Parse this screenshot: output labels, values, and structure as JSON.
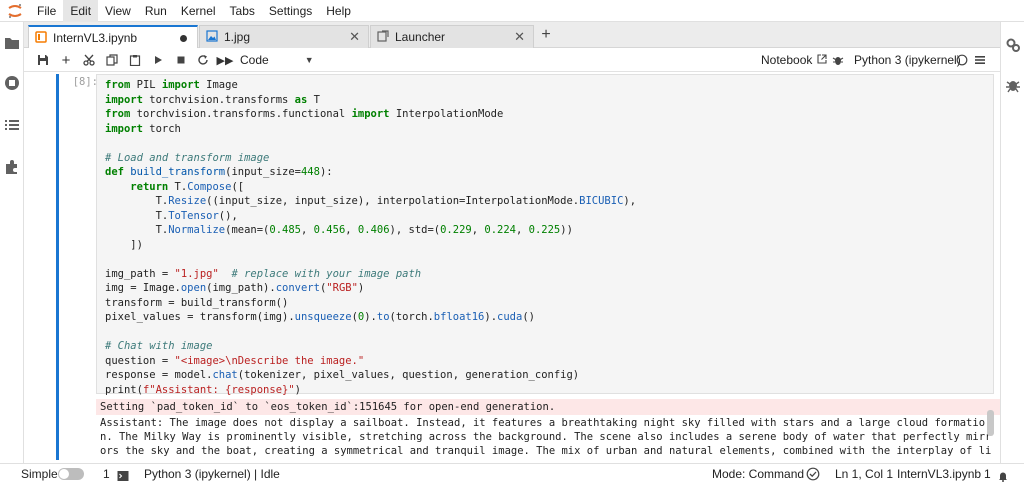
{
  "menubar": {
    "items": [
      "File",
      "Edit",
      "View",
      "Run",
      "Kernel",
      "Tabs",
      "Settings",
      "Help"
    ],
    "active_index": 1
  },
  "tabs": [
    {
      "label": "InternVL3.ipynb",
      "icon": "notebook-icon",
      "active": true,
      "dirty": true
    },
    {
      "label": "1.jpg",
      "icon": "image-icon",
      "active": false
    },
    {
      "label": "Launcher",
      "icon": "launcher-icon",
      "active": false
    }
  ],
  "toolbar": {
    "cell_type": "Code",
    "notebook_label": "Notebook",
    "kernel_label": "Python 3 (ipykernel)"
  },
  "cell": {
    "prompt": "[8]:",
    "code_lines": [
      "from PIL import Image",
      "import torchvision.transforms as T",
      "from torchvision.transforms.functional import InterpolationMode",
      "import torch",
      "",
      "# Load and transform image",
      "def build_transform(input_size=448):",
      "    return T.Compose([",
      "        T.Resize((input_size, input_size), interpolation=InterpolationMode.BICUBIC),",
      "        T.ToTensor(),",
      "        T.Normalize(mean=(0.485, 0.456, 0.406), std=(0.229, 0.224, 0.225))",
      "    ])",
      "",
      "img_path = \"1.jpg\"  # replace with your image path",
      "img = Image.open(img_path).convert(\"RGB\")",
      "transform = build_transform()",
      "pixel_values = transform(img).unsqueeze(0).to(torch.bfloat16).cuda()",
      "",
      "# Chat with image",
      "question = \"<image>\\nDescribe the image.\"",
      "response = model.chat(tokenizer, pixel_values, question, generation_config)",
      "print(f\"Assistant: {response}\")"
    ],
    "output": {
      "stderr": "Setting `pad_token_id` to `eos_token_id`:151645 for open-end generation.",
      "stdout_lines": [
        "Assistant: The image does not display a sailboat. Instead, it features a breathtaking night sky filled with stars and a large cloud formatio",
        "n. The Milky Way is prominently visible, stretching across the background. The scene also includes a serene body of water that perfectly mirr",
        "ors the sky and the boat, creating a symmetrical and tranquil image. The mix of urban and natural elements, combined with the interplay of li"
      ]
    }
  },
  "statusbar": {
    "mode_label": "Simple",
    "terminals_count": "1",
    "kernels_count": "1",
    "kernel_status": "Python 3 (ipykernel) | Idle",
    "command_mode": "Mode: Command",
    "cursor_position": "Ln 1, Col 1",
    "file_name": "InternVL3.ipynb",
    "notifications_count": "1"
  },
  "colors": {
    "accent": "#1976d2",
    "stderr_bg": "#fde7e7",
    "logo": "#e46e2e"
  }
}
